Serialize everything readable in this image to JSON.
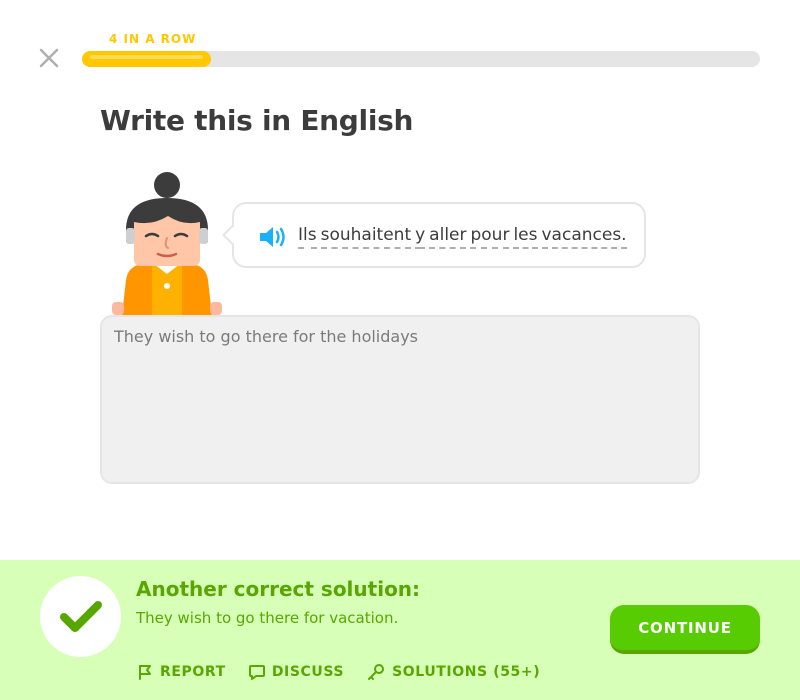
{
  "header": {
    "streak_label": "4 IN A ROW",
    "progress_fraction": 0.19
  },
  "lesson": {
    "title": "Write this in English",
    "sentence_words": [
      "Ils",
      "souhaitent",
      "y",
      "aller",
      "pour",
      "les",
      "vacances."
    ],
    "answer_value": "They wish to go there for the holidays"
  },
  "feedback": {
    "title": "Another correct solution:",
    "solution": "They wish to go there for vacation.",
    "continue_label": "CONTINUE",
    "actions": {
      "report": "REPORT",
      "discuss": "DISCUSS",
      "solutions": "SOLUTIONS (55+)"
    }
  },
  "icons": {
    "close": "close-icon",
    "speaker": "speaker-icon",
    "check": "checkmark-icon",
    "report": "flag-icon",
    "discuss": "speech-bubble-icon",
    "solutions": "key-icon"
  },
  "colors": {
    "streak": "#ffc800",
    "progress_track": "#e5e5e5",
    "footer_bg": "#d7ffb8",
    "success_text": "#58a700",
    "continue_btn": "#58cc02",
    "speaker": "#1cb0f6"
  }
}
